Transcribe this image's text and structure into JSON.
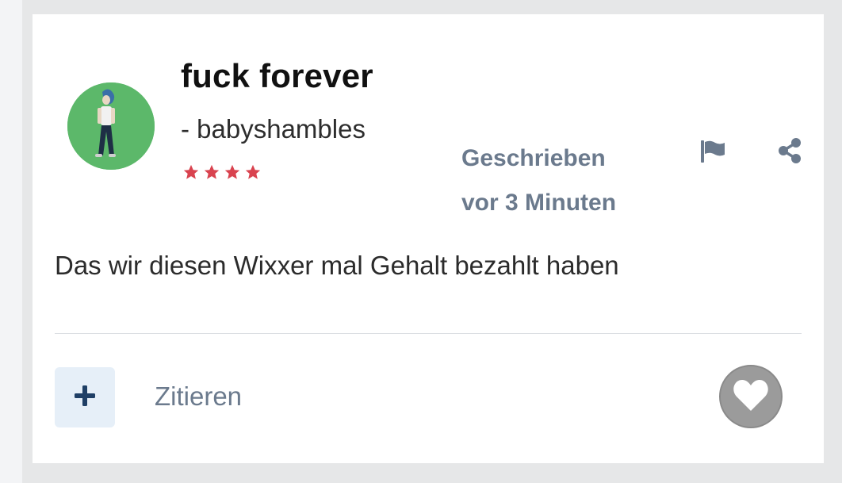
{
  "post": {
    "title": "fuck forever",
    "author": "- babyshambles",
    "rating_stars": 4,
    "written_label": "Geschrieben",
    "written_time": "vor 3 Minuten",
    "body": "Das wir diesen Wixxer mal Gehalt bezahlt haben"
  },
  "actions": {
    "quote_label": "Zitieren",
    "flag_icon": "flag-icon",
    "share_icon": "share-icon",
    "add_icon": "plus-icon",
    "like_icon": "heart-icon"
  },
  "colors": {
    "card_bg": "#ffffff",
    "page_bg": "#e6e7e8",
    "muted_text": "#6b7a8d",
    "accent_navy": "#1f3f66",
    "avatar_bg": "#5cb86a",
    "star_red": "#d9434f",
    "like_bg": "#9b9b9b"
  }
}
